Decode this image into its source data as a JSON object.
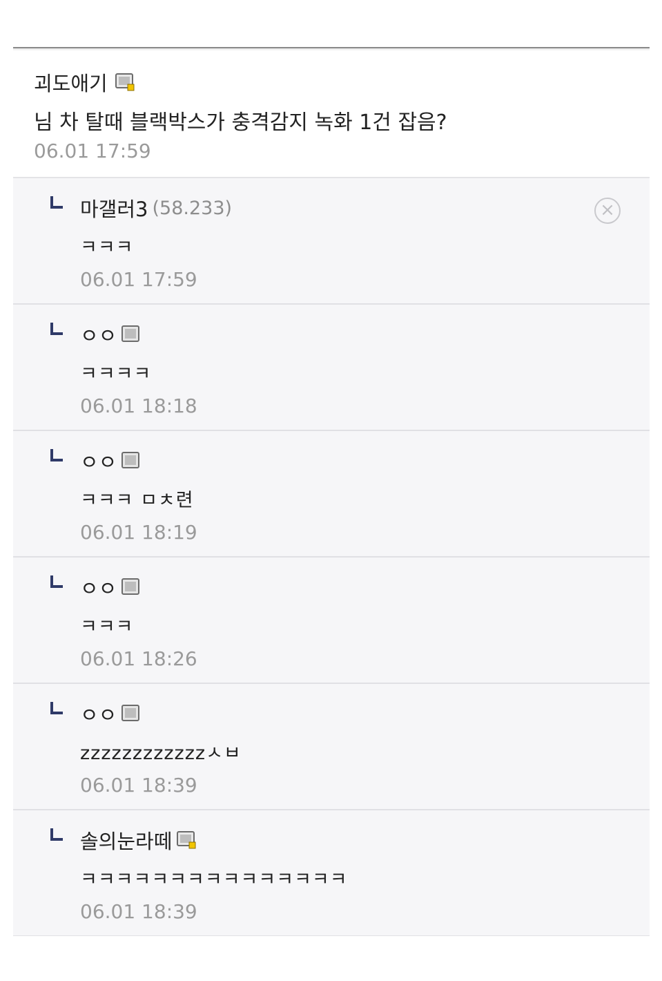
{
  "post": {
    "author": "괴도애기",
    "author_icon": "gallery-member-icon",
    "content": "님 차 탈때 블랙박스가 충격감지 녹화 1건 잡음?",
    "time": "06.01 17:59"
  },
  "comments": [
    {
      "nick": "마갤러3",
      "ip": "(58.233)",
      "body": "ㅋㅋㅋ",
      "time": "06.01 17:59",
      "has_delete": true
    },
    {
      "nick": "ㅇㅇ",
      "icon": "gallery-member-icon",
      "body": "ㅋㅋㅋㅋ",
      "time": "06.01 18:18"
    },
    {
      "nick": "ㅇㅇ",
      "icon": "gallery-member-icon",
      "body": "ㅋㅋㅋ ㅁㅊ련",
      "time": "06.01 18:19"
    },
    {
      "nick": "ㅇㅇ",
      "icon": "gallery-member-icon",
      "body": "ㅋㅋㅋ",
      "time": "06.01 18:26"
    },
    {
      "nick": "ㅇㅇ",
      "icon": "gallery-member-icon",
      "body": "zzzzzzzzzzzzㅅㅂ",
      "time": "06.01 18:39"
    },
    {
      "nick": "솔의눈라떼",
      "icon": "gallery-member-icon",
      "body": "ㅋㅋㅋㅋㅋㅋㅋㅋㅋㅋㅋㅋㅋㅋㅋ",
      "time": "06.01 18:39"
    }
  ],
  "delete_icon": "close-circle-icon",
  "colors": {
    "reply_mark": "#2f3a68",
    "timestamp": "#9a9a9a",
    "comment_bg": "#f6f6f8"
  }
}
